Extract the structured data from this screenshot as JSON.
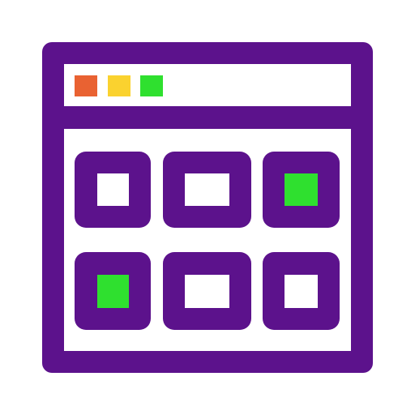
{
  "icon": {
    "name": "browser-window-grid-icon",
    "colors": {
      "frame": "#5c128c",
      "background": "#ffffff",
      "dot_red": "#e96232",
      "dot_yellow": "#fad22f",
      "dot_green": "#2fe02f",
      "tile_active": "#2fe02f"
    },
    "titlebar_dots": [
      "red-dot",
      "yellow-dot",
      "green-dot"
    ],
    "tiles": [
      {
        "name": "tile-1",
        "active": false
      },
      {
        "name": "tile-2",
        "active": false
      },
      {
        "name": "tile-3",
        "active": true
      },
      {
        "name": "tile-4",
        "active": true
      },
      {
        "name": "tile-5",
        "active": false
      },
      {
        "name": "tile-6",
        "active": false
      }
    ]
  }
}
